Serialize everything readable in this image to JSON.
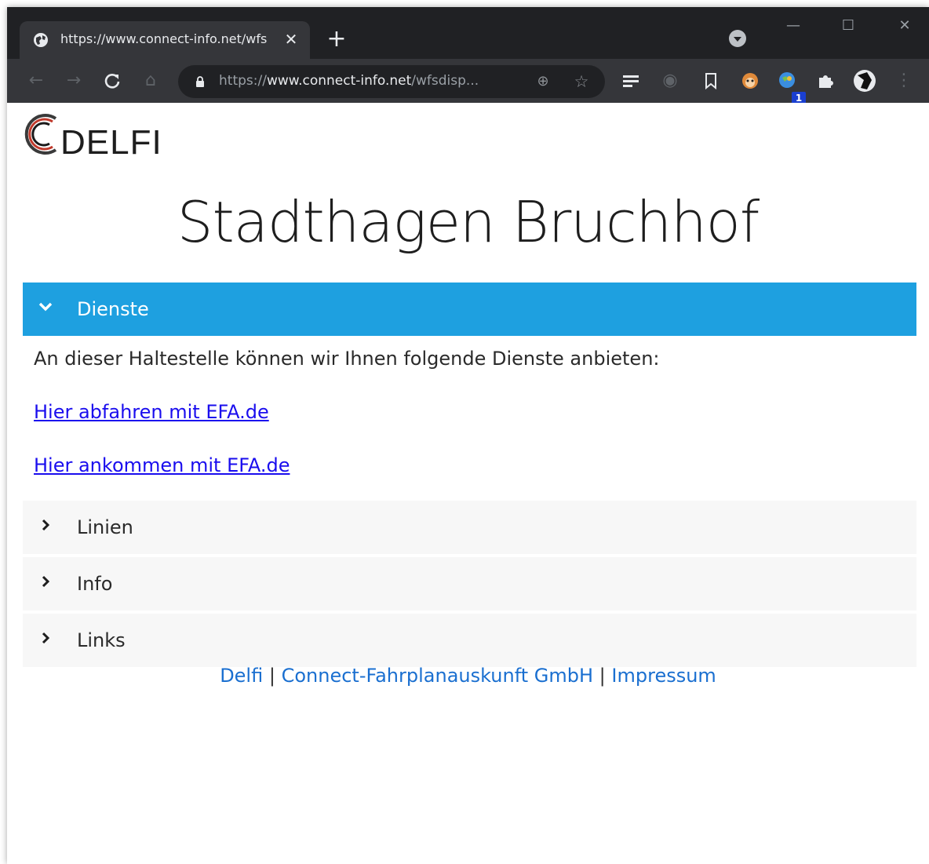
{
  "browser": {
    "tab_title": "https://www.connect-info.net/wfs",
    "url_prefix": "https://",
    "url_host": "www.connect-info.net",
    "url_path": "/wfsdisp...",
    "extension_badge": "1"
  },
  "header": {
    "logo_text": "DELFI",
    "title": "Stadthagen Bruchhof"
  },
  "sections": {
    "dienste": {
      "label": "Dienste",
      "description": "An dieser Haltestelle können wir Ihnen folgende Dienste anbieten:",
      "link_depart": "Hier abfahren mit EFA.de",
      "link_arrive": "Hier ankommen mit EFA.de"
    },
    "linien": {
      "label": "Linien"
    },
    "info": {
      "label": "Info"
    },
    "links": {
      "label": "Links"
    }
  },
  "footer": {
    "delfi": "Delfi",
    "separator": "|",
    "connect": "Connect-Fahrplanauskunft GmbH",
    "impressum": "Impressum"
  },
  "colors": {
    "accent": "#1ea0e0",
    "link": "#1a0dee",
    "footer_link": "#1a6fd0"
  }
}
